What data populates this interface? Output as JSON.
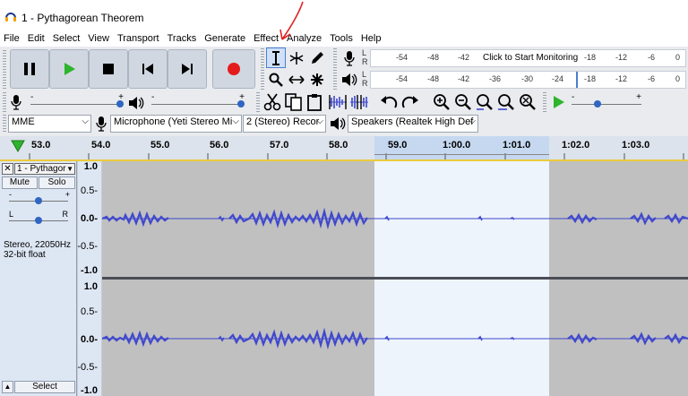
{
  "window": {
    "title": "1 - Pythagorean Theorem"
  },
  "menu": [
    "File",
    "Edit",
    "Select",
    "View",
    "Transport",
    "Tracks",
    "Generate",
    "Effect",
    "Analyze",
    "Tools",
    "Help"
  ],
  "meters": {
    "record_ticks": [
      "-54",
      "-48",
      "-42",
      "-18",
      "-12",
      "-6",
      "0"
    ],
    "record_prompt": "Click to Start Monitoring",
    "play_ticks": [
      "-54",
      "-48",
      "-42",
      "-36",
      "-30",
      "-24",
      "-18",
      "-12",
      "-6",
      "0"
    ],
    "lr": [
      "L",
      "R"
    ]
  },
  "sliders": {
    "minus": "-",
    "plus": "+"
  },
  "device": {
    "host": "MME",
    "mic": "Microphone (Yeti Stereo Mi",
    "channels": "2 (Stereo) Recor",
    "speakers": "Speakers (Realtek High Def"
  },
  "ruler": {
    "ticks": [
      "53.0",
      "54.0",
      "55.0",
      "56.0",
      "57.0",
      "58.0",
      "59.0",
      "1:00.0",
      "1:01.0",
      "1:02.0",
      "1:03.0"
    ]
  },
  "track": {
    "name": "1 - Pythagor",
    "mute": "Mute",
    "solo": "Solo",
    "gain_minus": "-",
    "gain_plus": "+",
    "pan_l": "L",
    "pan_r": "R",
    "format_rate": "Stereo, 22050Hz",
    "format_bits": "32-bit float",
    "select": "Select",
    "scale": [
      "1.0",
      "0.5-",
      "0.0-",
      "-0.5-",
      "-1.0"
    ]
  },
  "colors": {
    "waveform": "#3f48cc",
    "selection": "#eef4fc",
    "background": "#c0c0c0"
  },
  "icons": [
    "pause-icon",
    "play-icon",
    "stop-icon",
    "skip-start-icon",
    "skip-end-icon",
    "record-icon"
  ]
}
